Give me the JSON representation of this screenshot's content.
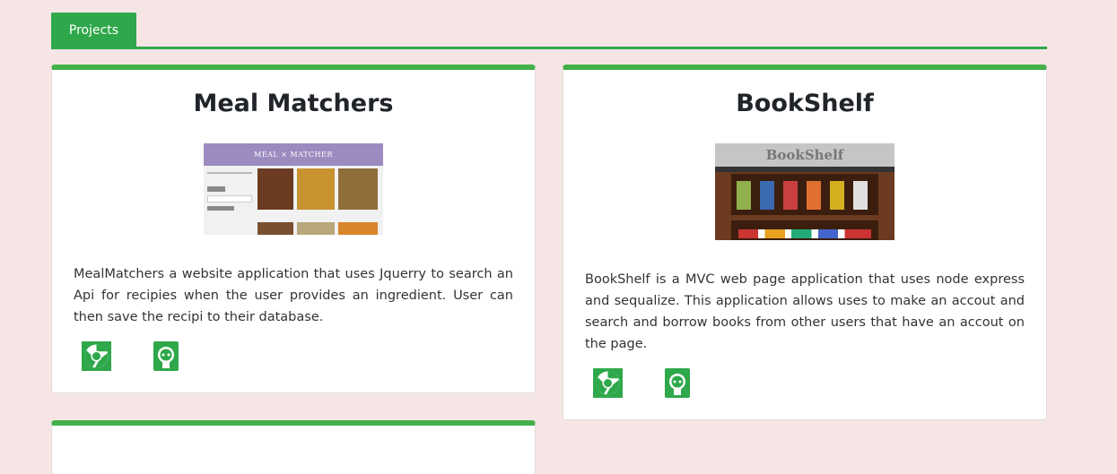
{
  "tabs": {
    "active_label": "Projects"
  },
  "projects": [
    {
      "title": "Meal Matchers",
      "screenshot_banner": "MEAL × MATCHER",
      "description": "MealMatchers a website application that uses Jquerry to search an Api for recipies when the user provides an ingredient. User can then save the recipi to their database.",
      "icons": [
        "chrome-icon",
        "github-icon"
      ]
    },
    {
      "title": "BookShelf",
      "screenshot_banner": "BookShelf",
      "description": "BookShelf is a MVC web page application that uses node express and sequalize. This application allows uses to make an accout and search and borrow books from other users that have an accout on the page.",
      "icons": [
        "chrome-icon",
        "github-icon"
      ]
    }
  ],
  "colors": {
    "accent": "#43b04a",
    "tab": "#2ea84a",
    "background": "#f5e6e5"
  }
}
